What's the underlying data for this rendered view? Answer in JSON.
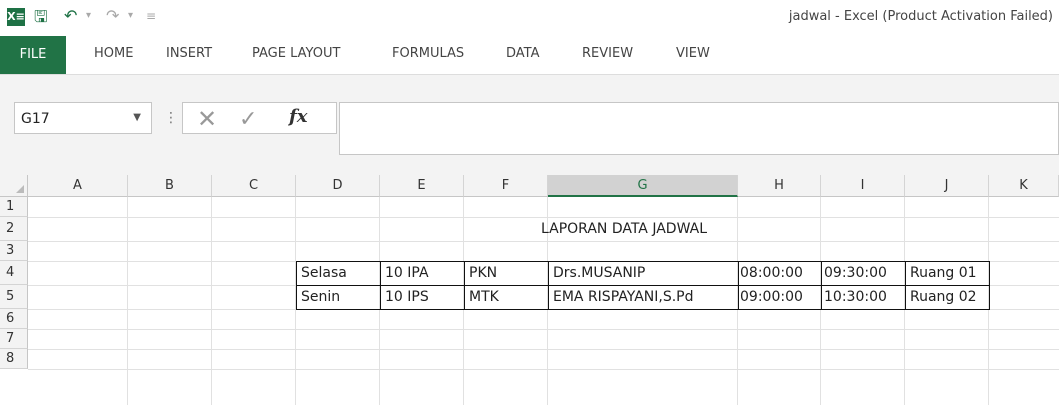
{
  "titlebar": {
    "logo_text": "X≡",
    "doc_title": "jadwal - Excel (Product Activation Failed)"
  },
  "ribbon": {
    "tabs": [
      "FILE",
      "HOME",
      "INSERT",
      "PAGE LAYOUT",
      "FORMULAS",
      "DATA",
      "REVIEW",
      "VIEW"
    ]
  },
  "formula_bar": {
    "name_box": "G17",
    "fx_label": "fx",
    "formula": ""
  },
  "sheet": {
    "columns": [
      "A",
      "B",
      "C",
      "D",
      "E",
      "F",
      "G",
      "H",
      "I",
      "J",
      "K"
    ],
    "rows": [
      "1",
      "2",
      "3",
      "4",
      "5",
      "6",
      "7",
      "8"
    ],
    "title": "LAPORAN DATA JADWAL",
    "table": [
      [
        "Selasa",
        "10 IPA",
        "PKN",
        "Drs.MUSANIP",
        "08:00:00",
        "09:30:00",
        "Ruang 01"
      ],
      [
        "Senin",
        "10 IPS",
        "MTK",
        "EMA RISPAYANI,S.Pd",
        "09:00:00",
        "10:30:00",
        "Ruang 02"
      ]
    ]
  }
}
